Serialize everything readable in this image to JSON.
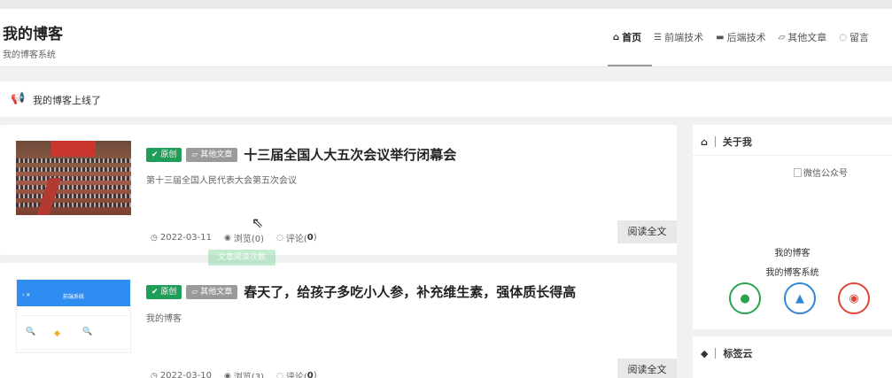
{
  "site": {
    "title": "我的博客",
    "subtitle": "我的博客系统"
  },
  "nav": {
    "items": [
      {
        "icon": "home-icon",
        "label": "首页",
        "active": true
      },
      {
        "icon": "code-icon",
        "label": "前端技术",
        "active": false
      },
      {
        "icon": "server-icon",
        "label": "后端技术",
        "active": false
      },
      {
        "icon": "folder-icon",
        "label": "其他文章",
        "active": false
      },
      {
        "icon": "chat-icon",
        "label": "留言",
        "active": false
      }
    ]
  },
  "notice": {
    "text": "我的博客上线了"
  },
  "posts": [
    {
      "original_badge": "原创",
      "category_badge": "其他文章",
      "title": "十三届全国人大五次会议举行闭幕会",
      "summary": "第十三届全国人民代表大会第五次会议",
      "date": "2022-03-11",
      "views": "浏览(0)",
      "comments_label": "评论(",
      "comments_count": "0",
      "comments_close": ")",
      "read_more": "阅读全文"
    },
    {
      "original_badge": "原创",
      "category_badge": "其他文章",
      "title": "春天了，给孩子多吃小人参，补充维生素，强体质长得高",
      "summary": "我的博客",
      "date": "2022-03-10",
      "views": "浏览(3)",
      "comments_label": "评论(",
      "comments_count": "0",
      "comments_close": ")",
      "read_more": "阅读全文"
    }
  ],
  "tooltip": {
    "text": "文章阅读次数"
  },
  "sidebar": {
    "about": {
      "heading": "关于我",
      "qr_alt": "微信公众号",
      "name": "我的博客",
      "desc": "我的博客系统",
      "social": [
        "wechat-icon",
        "qq-icon",
        "weibo-icon"
      ]
    },
    "tags": {
      "heading": "标签云"
    }
  },
  "thumb2": {
    "app_title": "前端系统"
  },
  "colors": {
    "original_badge": "#1e9e58",
    "category_badge": "#9a9a9a",
    "notice_icon": "#f0ad1e",
    "wechat": "#2aa44c",
    "qq": "#2f86d6",
    "weibo": "#e0453a"
  }
}
